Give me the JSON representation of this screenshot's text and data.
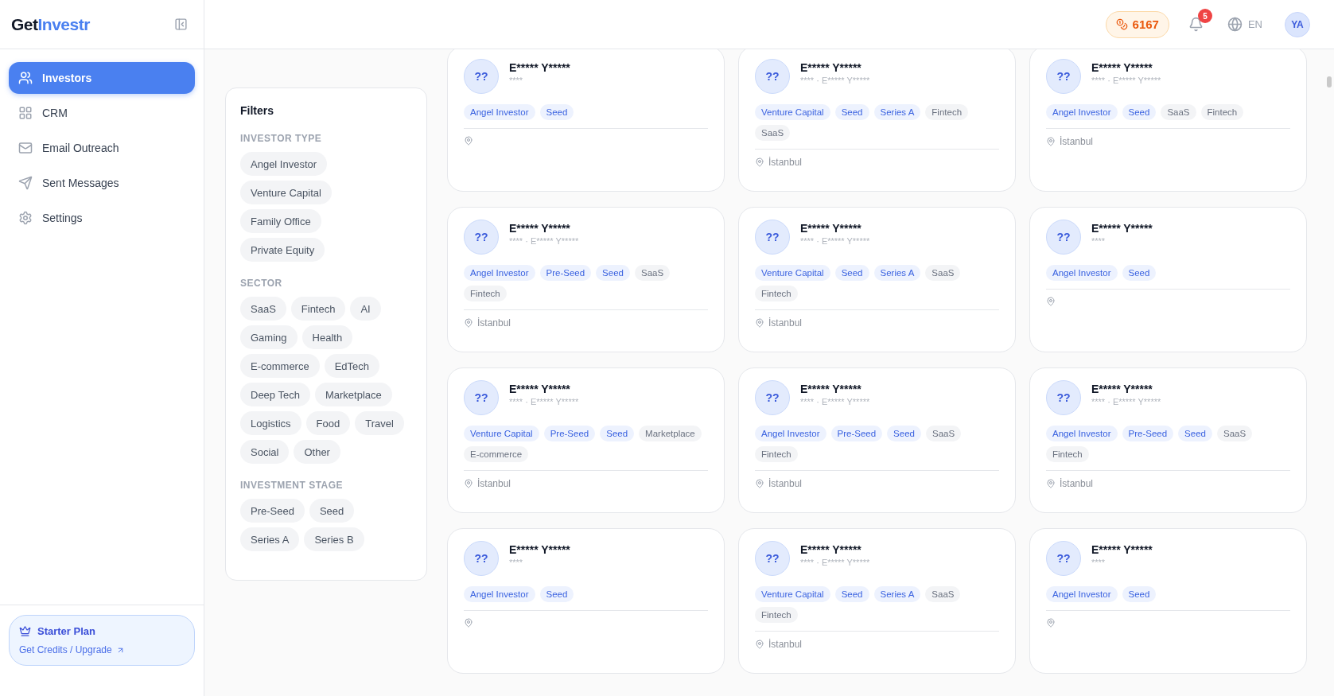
{
  "sidebar": {
    "logo": {
      "part_1": "Get",
      "part_2": "Investr"
    },
    "items": [
      {
        "label": "Investors",
        "selected": true
      },
      {
        "label": "CRM",
        "selected": false
      },
      {
        "label": "Email Outreach",
        "selected": false
      },
      {
        "label": "Sent Messages",
        "selected": false
      },
      {
        "label": "Settings",
        "selected": false
      }
    ],
    "plan": {
      "title": "Starter Plan",
      "link": "Get Credits / Upgrade"
    }
  },
  "header": {
    "credits": "6167",
    "notifications": "5",
    "language": "EN",
    "avatar": "YA"
  },
  "filters": {
    "title": "Filters",
    "groups": [
      {
        "title": "INVESTOR TYPE",
        "options": [
          "Angel Investor",
          "Venture Capital",
          "Family Office",
          "Private Equity"
        ]
      },
      {
        "title": "SECTOR",
        "options": [
          "SaaS",
          "Fintech",
          "AI",
          "Gaming",
          "Health",
          "E-commerce",
          "EdTech",
          "Deep Tech",
          "Marketplace",
          "Logistics",
          "Food",
          "Travel",
          "Social",
          "Other"
        ]
      },
      {
        "title": "INVESTMENT STAGE",
        "options": [
          "Pre-Seed",
          "Seed",
          "Series A",
          "Series B"
        ]
      }
    ]
  },
  "investors": [
    {
      "avatar": "??",
      "name": "E***** Y*****",
      "subtitle": "****",
      "tags": [
        {
          "label": "Angel Investor",
          "kind": "type"
        },
        {
          "label": "Seed",
          "kind": "stage"
        }
      ]
    },
    {
      "avatar": "??",
      "name": "E***** Y*****",
      "subtitle": "**** · E***** Y*****",
      "tags": [
        {
          "label": "Venture Capital",
          "kind": "type"
        },
        {
          "label": "Seed",
          "kind": "stage"
        },
        {
          "label": "Series A",
          "kind": "stage"
        },
        {
          "label": "Fintech",
          "kind": "sector"
        },
        {
          "label": "SaaS",
          "kind": "sector"
        }
      ],
      "location": "İstanbul"
    },
    {
      "avatar": "??",
      "name": "E***** Y*****",
      "subtitle": "**** · E***** Y*****",
      "tags": [
        {
          "label": "Angel Investor",
          "kind": "type"
        },
        {
          "label": "Seed",
          "kind": "stage"
        },
        {
          "label": "SaaS",
          "kind": "sector"
        },
        {
          "label": "Fintech",
          "kind": "sector"
        }
      ],
      "location": "İstanbul"
    },
    {
      "avatar": "??",
      "name": "E***** Y*****",
      "subtitle": "**** · E***** Y*****",
      "tags": [
        {
          "label": "Angel Investor",
          "kind": "type"
        },
        {
          "label": "Pre-Seed",
          "kind": "stage"
        },
        {
          "label": "Seed",
          "kind": "stage"
        },
        {
          "label": "SaaS",
          "kind": "sector"
        },
        {
          "label": "Fintech",
          "kind": "sector"
        }
      ],
      "location": "İstanbul"
    },
    {
      "avatar": "??",
      "name": "E***** Y*****",
      "subtitle": "**** · E***** Y*****",
      "tags": [
        {
          "label": "Venture Capital",
          "kind": "type"
        },
        {
          "label": "Seed",
          "kind": "stage"
        },
        {
          "label": "Series A",
          "kind": "stage"
        },
        {
          "label": "SaaS",
          "kind": "sector"
        },
        {
          "label": "Fintech",
          "kind": "sector"
        }
      ],
      "location": "İstanbul"
    },
    {
      "avatar": "??",
      "name": "E***** Y*****",
      "subtitle": "****",
      "tags": [
        {
          "label": "Angel Investor",
          "kind": "type"
        },
        {
          "label": "Seed",
          "kind": "stage"
        }
      ]
    },
    {
      "avatar": "??",
      "name": "E***** Y*****",
      "subtitle": "**** · E***** Y*****",
      "tags": [
        {
          "label": "Venture Capital",
          "kind": "type"
        },
        {
          "label": "Pre-Seed",
          "kind": "stage"
        },
        {
          "label": "Seed",
          "kind": "stage"
        },
        {
          "label": "Marketplace",
          "kind": "sector"
        },
        {
          "label": "E-commerce",
          "kind": "sector"
        }
      ],
      "location": "İstanbul"
    },
    {
      "avatar": "??",
      "name": "E***** Y*****",
      "subtitle": "**** · E***** Y*****",
      "tags": [
        {
          "label": "Angel Investor",
          "kind": "type"
        },
        {
          "label": "Pre-Seed",
          "kind": "stage"
        },
        {
          "label": "Seed",
          "kind": "stage"
        },
        {
          "label": "SaaS",
          "kind": "sector"
        },
        {
          "label": "Fintech",
          "kind": "sector"
        }
      ],
      "location": "İstanbul"
    },
    {
      "avatar": "??",
      "name": "E***** Y*****",
      "subtitle": "**** · E***** Y*****",
      "tags": [
        {
          "label": "Angel Investor",
          "kind": "type"
        },
        {
          "label": "Pre-Seed",
          "kind": "stage"
        },
        {
          "label": "Seed",
          "kind": "stage"
        },
        {
          "label": "SaaS",
          "kind": "sector"
        },
        {
          "label": "Fintech",
          "kind": "sector"
        }
      ],
      "location": "İstanbul"
    },
    {
      "avatar": "??",
      "name": "E***** Y*****",
      "subtitle": "****",
      "tags": [
        {
          "label": "Angel Investor",
          "kind": "type"
        },
        {
          "label": "Seed",
          "kind": "stage"
        }
      ]
    },
    {
      "avatar": "??",
      "name": "E***** Y*****",
      "subtitle": "**** · E***** Y*****",
      "tags": [
        {
          "label": "Venture Capital",
          "kind": "type"
        },
        {
          "label": "Seed",
          "kind": "stage"
        },
        {
          "label": "Series A",
          "kind": "stage"
        },
        {
          "label": "SaaS",
          "kind": "sector"
        },
        {
          "label": "Fintech",
          "kind": "sector"
        }
      ],
      "location": "İstanbul"
    },
    {
      "avatar": "??",
      "name": "E***** Y*****",
      "subtitle": "****",
      "tags": [
        {
          "label": "Angel Investor",
          "kind": "type"
        },
        {
          "label": "Seed",
          "kind": "stage"
        }
      ]
    }
  ]
}
